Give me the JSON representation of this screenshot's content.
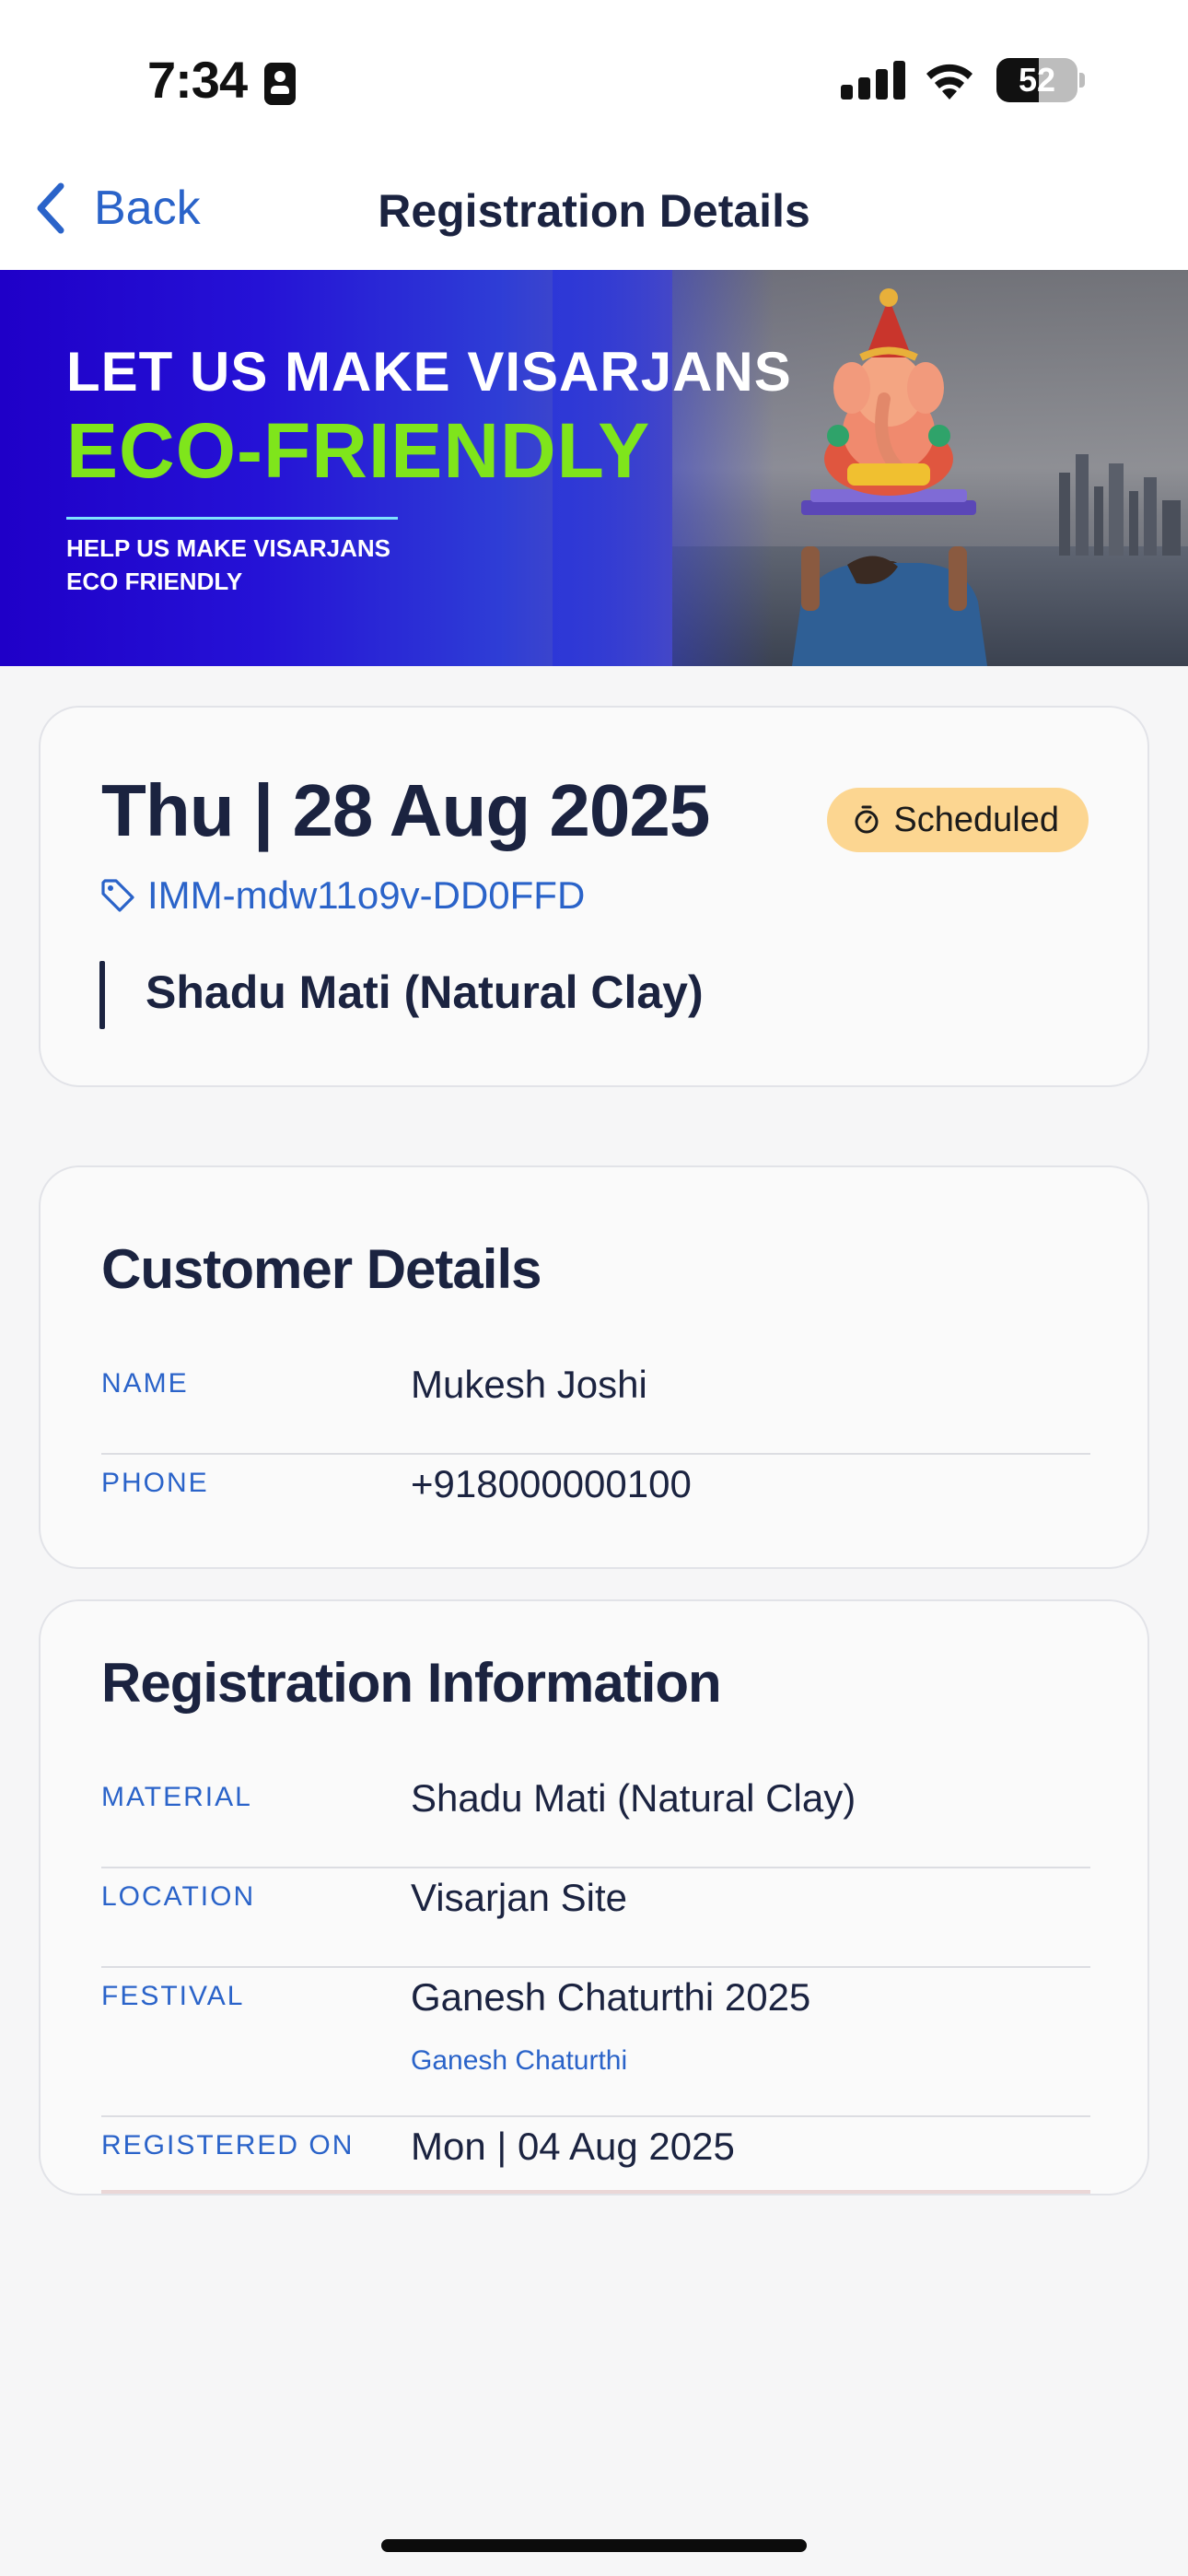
{
  "status_bar": {
    "time": "7:34",
    "battery_level": "52",
    "battery_fraction": 0.52,
    "icons": [
      "id-card-icon",
      "cellular-signal-icon",
      "wifi-icon",
      "battery-icon"
    ]
  },
  "nav": {
    "back_label": "Back",
    "title": "Registration Details"
  },
  "banner": {
    "headline": "LET US MAKE VISARJANS",
    "highlight": "ECO-FRIENDLY",
    "subtext": "HELP US MAKE VISARJANS\nECO FRIENDLY",
    "colors": {
      "highlight": "#7fe51b",
      "background_start": "#1f00c8"
    }
  },
  "summary": {
    "date": "Thu | 28 Aug 2025",
    "status": "Scheduled",
    "registration_id": "IMM-mdw11o9v-DD0FFD",
    "material": "Shadu Mati (Natural Clay)",
    "colors": {
      "badge": "#fcd691",
      "link": "#2a63c9"
    }
  },
  "customer": {
    "title": "Customer Details",
    "rows": [
      {
        "label": "NAME",
        "value": "Mukesh Joshi"
      },
      {
        "label": "PHONE",
        "value": "+918000000100"
      }
    ]
  },
  "registration": {
    "title": "Registration Information",
    "rows": [
      {
        "label": "MATERIAL",
        "value": "Shadu Mati (Natural Clay)"
      },
      {
        "label": "LOCATION",
        "value": "Visarjan Site"
      },
      {
        "label": "FESTIVAL",
        "value": "Ganesh Chaturthi 2025",
        "subvalue": "Ganesh Chaturthi"
      },
      {
        "label": "REGISTERED ON",
        "value": "Mon | 04 Aug 2025"
      }
    ]
  }
}
